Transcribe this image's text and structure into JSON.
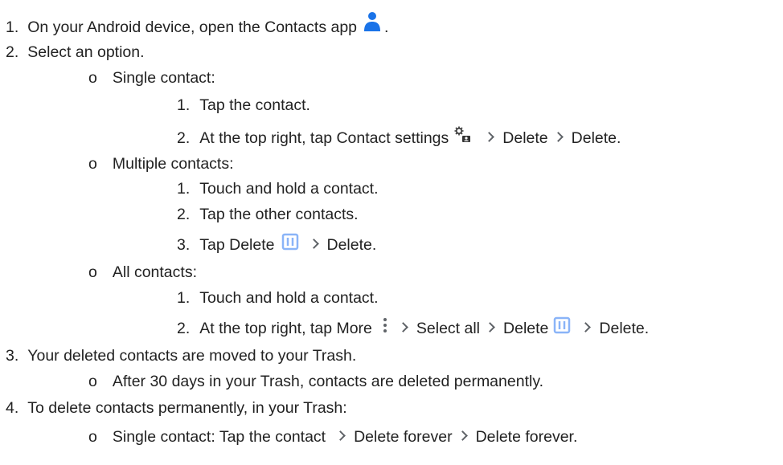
{
  "steps": [
    {
      "num": "1.",
      "text": "On your Android device, open the Contacts app",
      "end": "."
    },
    {
      "num": "2.",
      "text": "Select an option."
    },
    {
      "bullet": "o",
      "text": "Single contact:"
    },
    {
      "num": "1.",
      "text": "Tap the contact."
    },
    {
      "num": "2.",
      "text": "At the top right, tap Contact settings",
      "a": "Delete",
      "b": "Delete."
    },
    {
      "bullet": "o",
      "text": "Multiple contacts:"
    },
    {
      "num": "1.",
      "text": "Touch and hold a contact."
    },
    {
      "num": "2.",
      "text": "Tap the other contacts."
    },
    {
      "num": "3.",
      "text": "Tap Delete",
      "a": "Delete."
    },
    {
      "bullet": "o",
      "text": "All contacts:"
    },
    {
      "num": "1.",
      "text": "Touch and hold a contact."
    },
    {
      "num": "2.",
      "text": "At the top right, tap More",
      "a": "Select all",
      "b": "Delete",
      "c": "Delete."
    },
    {
      "num": "3.",
      "text": "Your deleted contacts are moved to your Trash."
    },
    {
      "bullet": "o",
      "text": "After 30 days in your Trash, contacts are deleted permanently."
    },
    {
      "num": "4.",
      "text": "To delete contacts permanently, in your Trash:"
    },
    {
      "bullet": "o",
      "text": "Single contact: Tap the contact",
      "a": "Delete forever",
      "b": "Delete forever."
    }
  ],
  "icons": {
    "contacts_app": "person-icon",
    "contact_settings": "gear-person-icon",
    "delete": "trash-icon",
    "more": "more-vert-icon",
    "chevron": "chevron-right-icon",
    "accent": "#1a73e8",
    "icon_gray": "#5f6368"
  }
}
